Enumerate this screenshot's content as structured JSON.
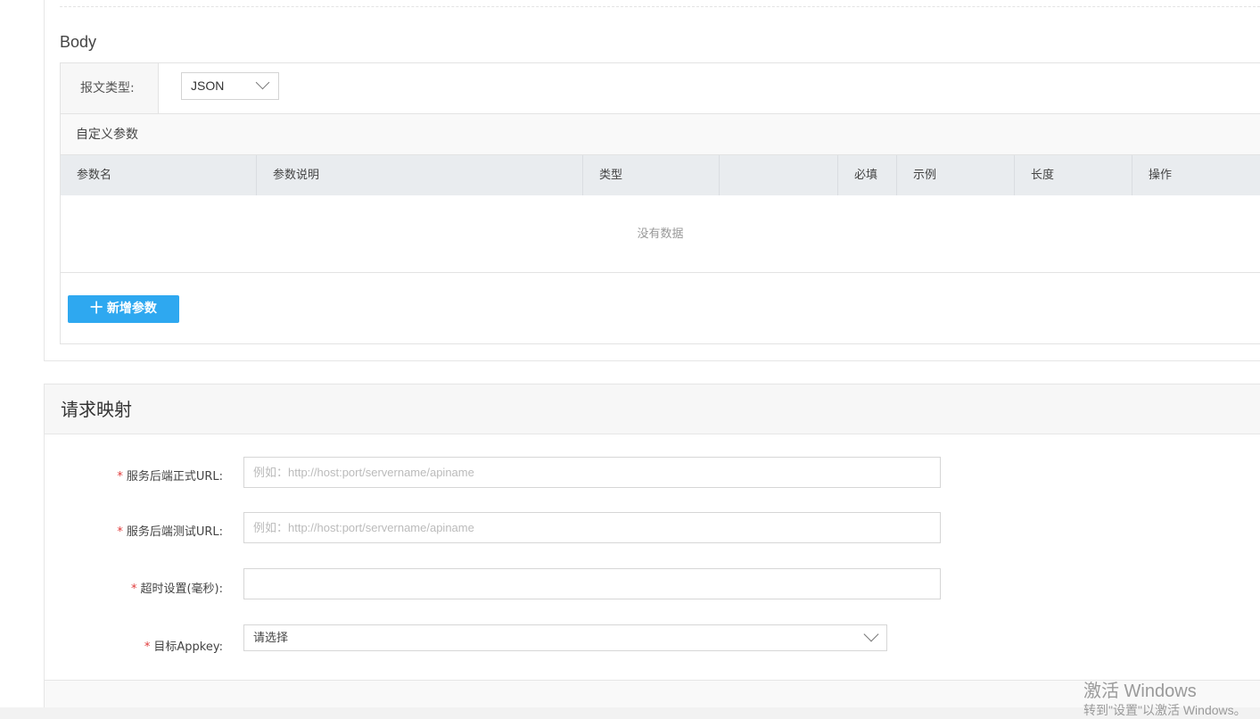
{
  "body_section": {
    "title": "Body",
    "msg_type_label": "报文类型:",
    "msg_type_value": "JSON",
    "custom_params_label": "自定义参数",
    "columns": [
      "参数名",
      "参数说明",
      "类型",
      "",
      "必填",
      "示例",
      "长度",
      "操作"
    ],
    "empty_text": "没有数据",
    "add_button": "十 新增参数"
  },
  "mapping": {
    "title": "请求映射",
    "fields": [
      {
        "required": "*",
        "label": "服务后端正式URL:",
        "placeholder": "例如：http://host:port/servername/apiname",
        "value": ""
      },
      {
        "required": "*",
        "label": "服务后端测试URL:",
        "placeholder": "例如：http://host:port/servername/apiname",
        "value": ""
      },
      {
        "required": "*",
        "label": "超时设置(毫秒):",
        "placeholder": "",
        "value": ""
      },
      {
        "required": "*",
        "label": "目标Appkey:",
        "placeholder": "请选择",
        "value": ""
      }
    ]
  },
  "watermark": {
    "line1": "激活 Windows",
    "line2": "转到\"设置\"以激活 Windows。"
  }
}
